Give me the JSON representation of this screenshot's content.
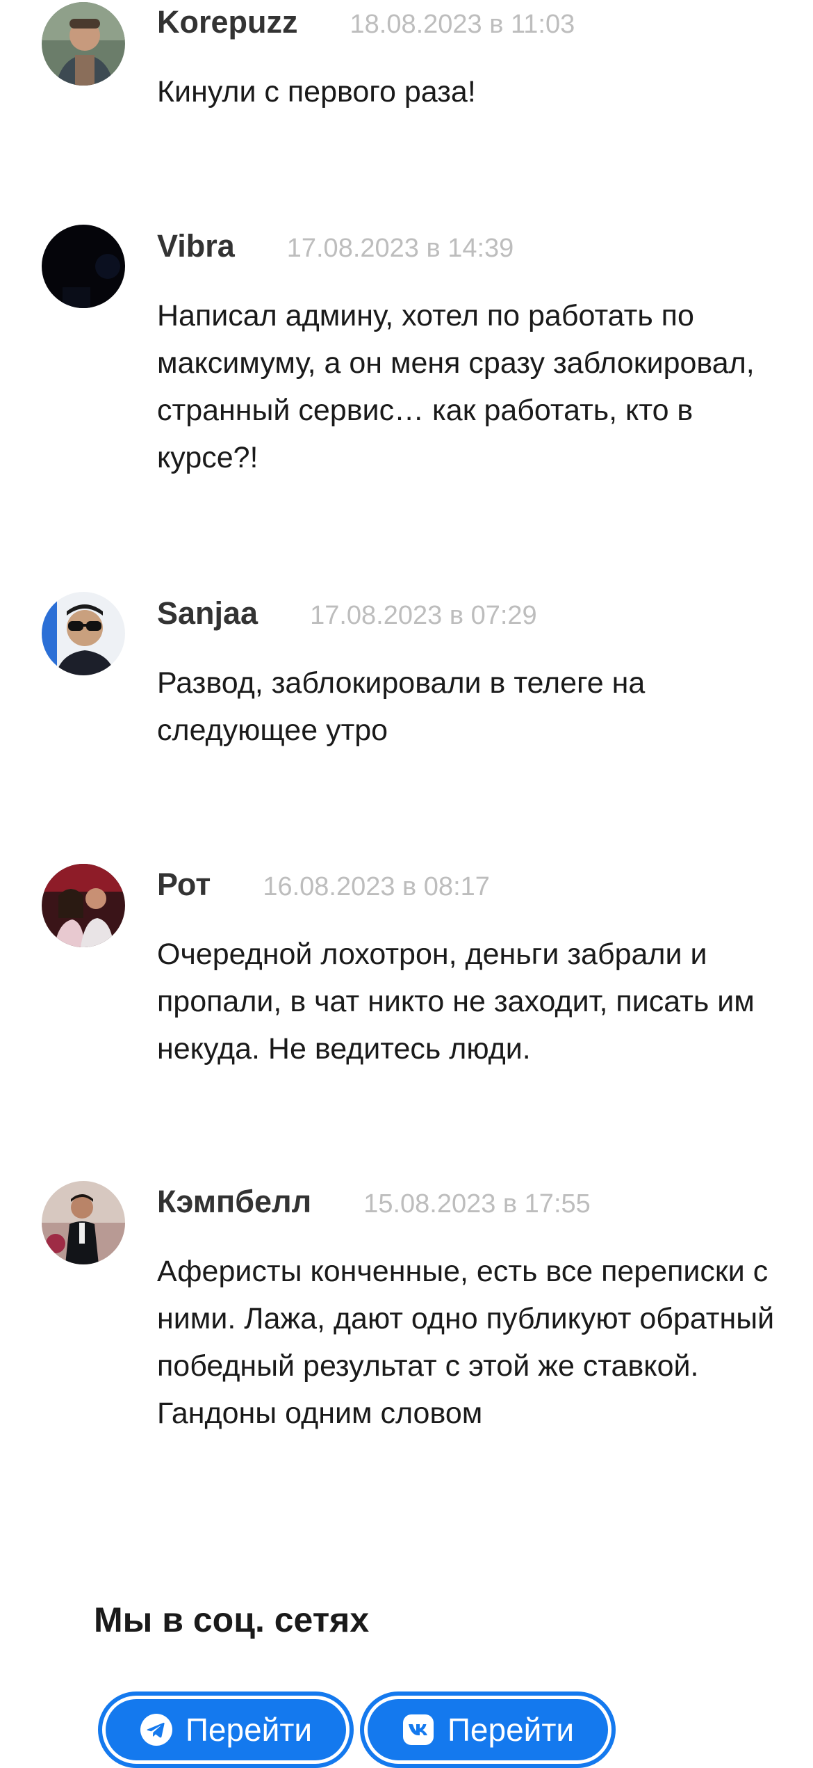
{
  "comments": [
    {
      "author": "Korepuzz",
      "date": "18.08.2023 в 11:03",
      "text": "Кинули с первого раза!",
      "avatar_icon": "user-photo-avatar"
    },
    {
      "author": "Vibra",
      "date": "17.08.2023 в 14:39",
      "text": "Написал админу, хотел по работать по максимуму, а он меня сразу заблокировал, странный сервис… как работать, кто в курсе?!",
      "avatar_icon": "dark-photo-avatar"
    },
    {
      "author": "Sanjaa",
      "date": "17.08.2023 в 07:29",
      "text": "Развод, заблокировали в телеге на следующее утро",
      "avatar_icon": "user-photo-avatar"
    },
    {
      "author": "Рот",
      "date": "16.08.2023 в 08:17",
      "text": "Очередной лохотрон, деньги забрали и пропали, в чат никто не заходит, писать им некуда. Не ведитесь люди.",
      "avatar_icon": "couple-photo-avatar"
    },
    {
      "author": "Кэмпбелл",
      "date": "15.08.2023 в 17:55",
      "text": "Аферисты конченные, есть все переписки с ними. Лажа, дают одно публикуют обратный победный результат с этой же ставкой. Гандоны одним словом",
      "avatar_icon": "user-photo-avatar"
    }
  ],
  "social": {
    "title": "Мы в соц. сетях",
    "buttons": [
      {
        "label": "Перейти",
        "icon": "telegram-icon"
      },
      {
        "label": "Перейти",
        "icon": "vk-icon"
      }
    ]
  },
  "colors": {
    "accent": "#1479ee",
    "date": "#bdbdbd",
    "text": "#1a1a1a"
  }
}
